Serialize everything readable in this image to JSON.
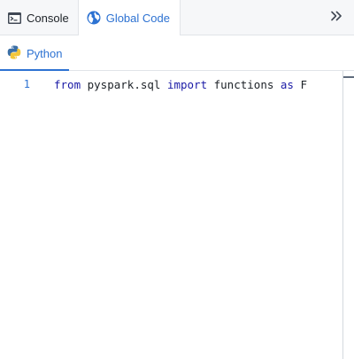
{
  "tabs": {
    "console_label": "Console",
    "global_code_label": "Global Code",
    "console_icon": "console-icon",
    "global_code_icon": "globe-icon",
    "collapse_icon": "double-chevron-right-icon"
  },
  "language_tab": {
    "label": "Python",
    "icon": "python-icon"
  },
  "editor": {
    "line_number": "1",
    "tokens": {
      "kw_from": "from",
      "module": " pyspark.sql ",
      "kw_import": "import",
      "name": " functions ",
      "kw_as": "as",
      "alias": " F"
    }
  },
  "colors": {
    "accent": "#2d72d2",
    "keyword": "#1a1aa6",
    "tab_bar_bg": "#f6f7f9"
  }
}
